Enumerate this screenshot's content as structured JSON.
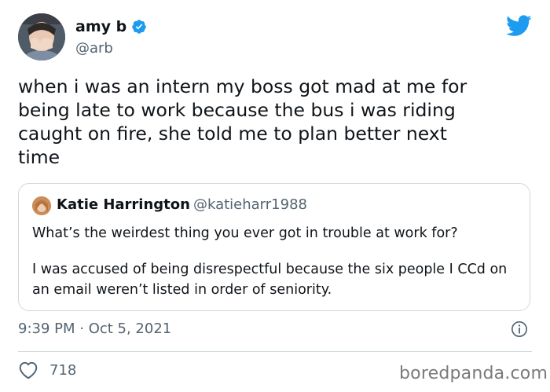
{
  "author": {
    "display_name": "amy b",
    "handle": "@arb",
    "verified": true
  },
  "tweet": {
    "text": "when i was an intern my boss got mad at me for\nbeing late to work because the bus i was riding\ncaught on fire, she told me to plan better next\ntime",
    "timestamp": "9:39 PM · Oct 5, 2021",
    "likes": "718"
  },
  "quoted_tweet": {
    "display_name": "Katie Harrington",
    "handle": "@katieharr1988",
    "paragraph1": "What’s the weirdest thing you ever got in trouble at work for?",
    "paragraph2": "I was accused of being disrespectful because the six people I CCd on an email weren’t listed in order of seniority."
  },
  "watermark": "boredpanda.com",
  "colors": {
    "twitter_blue": "#1d9bf0",
    "secondary_text": "#536471",
    "border": "#cfd9de"
  },
  "icons": {
    "brand": "twitter-bird-icon",
    "verified": "verified-badge-icon",
    "info": "info-icon",
    "like": "heart-icon"
  }
}
